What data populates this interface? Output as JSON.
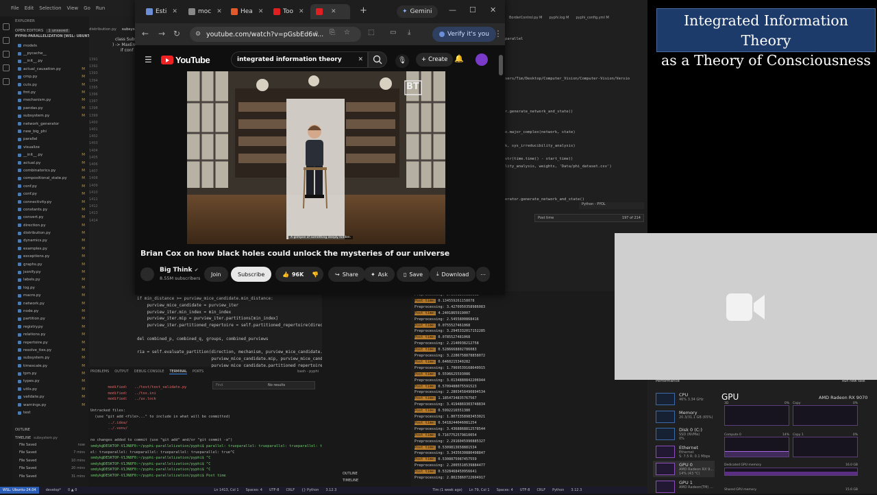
{
  "vscode": {
    "menu": [
      "File",
      "Edit",
      "Selection",
      "View",
      "Go",
      "Run"
    ],
    "explorer_title": "EXPLORER",
    "open_editors": "OPEN EDITORS",
    "open_editors_badge": "1 unsaved",
    "workspace": "PYPHI-PARALLELIZATION [WSL: UBUNTU-24.04]",
    "files": [
      {
        "name": "models",
        "status": ""
      },
      {
        "name": "__pycache__",
        "status": ""
      },
      {
        "name": "__init__.py",
        "status": ""
      },
      {
        "name": "actual_causation.py",
        "status": "M"
      },
      {
        "name": "cmp.py",
        "status": "M"
      },
      {
        "name": "cuts.py",
        "status": "M"
      },
      {
        "name": "fmt.py",
        "status": "M"
      },
      {
        "name": "mechanism.py",
        "status": "M"
      },
      {
        "name": "pandas.py",
        "status": "M"
      },
      {
        "name": "subsystem.py",
        "status": "M"
      },
      {
        "name": "network_generator",
        "status": ""
      },
      {
        "name": "new_big_phi",
        "status": ""
      },
      {
        "name": "parallel",
        "status": ""
      },
      {
        "name": "visualize",
        "status": ""
      },
      {
        "name": "__init__.py",
        "status": "M"
      },
      {
        "name": "actual.py",
        "status": "M"
      },
      {
        "name": "combinatorics.py",
        "status": "M"
      },
      {
        "name": "compositional_state.py",
        "status": "M"
      },
      {
        "name": "conf.py",
        "status": "M"
      },
      {
        "name": "conf.py",
        "status": "M"
      },
      {
        "name": "connectivity.py",
        "status": "M"
      },
      {
        "name": "constants.py",
        "status": "M"
      },
      {
        "name": "convert.py",
        "status": "M"
      },
      {
        "name": "direction.py",
        "status": "M"
      },
      {
        "name": "distribution.py",
        "status": "M"
      },
      {
        "name": "dynamics.py",
        "status": "M"
      },
      {
        "name": "examples.py",
        "status": "M"
      },
      {
        "name": "exceptions.py",
        "status": "M"
      },
      {
        "name": "graphs.py",
        "status": "M"
      },
      {
        "name": "jsonify.py",
        "status": "M"
      },
      {
        "name": "labels.py",
        "status": "M"
      },
      {
        "name": "log.py",
        "status": "M"
      },
      {
        "name": "macro.py",
        "status": "M"
      },
      {
        "name": "network.py",
        "status": "M"
      },
      {
        "name": "node.py",
        "status": "M"
      },
      {
        "name": "partition.py",
        "status": "M"
      },
      {
        "name": "registry.py",
        "status": "M"
      },
      {
        "name": "relations.py",
        "status": "M"
      },
      {
        "name": "repertoire.py",
        "status": "M"
      },
      {
        "name": "resolve_ties.py",
        "status": "M"
      },
      {
        "name": "subsystem.py",
        "status": "M"
      },
      {
        "name": "timescale.py",
        "status": "M"
      },
      {
        "name": "tpm.py",
        "status": "M"
      },
      {
        "name": "types.py",
        "status": "M"
      },
      {
        "name": "utils.py",
        "status": "M"
      },
      {
        "name": "validate.py",
        "status": "M"
      },
      {
        "name": "warnings.py",
        "status": "M"
      },
      {
        "name": "test",
        "status": ""
      }
    ],
    "outline": "OUTLINE",
    "timeline": "TIMELINE",
    "timeline_file": "subsystem.py",
    "timeline_items": [
      {
        "label": "File Saved",
        "time": "now"
      },
      {
        "label": "File Saved",
        "time": "7 mins"
      },
      {
        "label": "File Saved",
        "time": "10 mins"
      },
      {
        "label": "File Saved",
        "time": "20 mins"
      },
      {
        "label": "File Saved",
        "time": "31 mins"
      }
    ],
    "editor_tabs": [
      "distribution.py",
      "subsystem.py"
    ],
    "code_top": [
      "class Subsystem:",
      ") -> MaxEnt",
      "if conf"
    ],
    "code_bottom": [
      "if min_distance >= purview_mice_candidate.min_distance:",
      "    purview_mice_candidate = purview_iter",
      "    purview_iter.min_index = min_index",
      "    purview_iter.mip = purview_iter.partitions[min_index]",
      "    purview_iter.partitioned_repertoire = self.partitioned_repertoire(direction,",
      "",
      "del combined_p, combined_q, groups, combined_purviews",
      "",
      "ria = self.evaluate_partition(direction, mechanism, purview_mice_candidate.purview,",
      "                              purview_mice_candidate.mip, purview_mice_candidate.re",
      "                              purview_mice_candidate.partitioned_repertoire)"
    ],
    "line_numbers": [
      "1391",
      "1392",
      "1393",
      "1394",
      "1395",
      "1396",
      "1397",
      "1398",
      "1399",
      "1400",
      "1401",
      "1402",
      "1403",
      "1404",
      "1405",
      "1406",
      "1407",
      "1408",
      "1409",
      "1410",
      "1411",
      "1412",
      "1413",
      "1414"
    ],
    "panel_tabs": [
      "PROBLEMS",
      "OUTPUT",
      "DEBUG CONSOLE",
      "TERMINAL",
      "PORTS"
    ],
    "terminal_name": "bash - pyphi",
    "find_placeholder": "Find",
    "find_result": "No results",
    "terminal_lines": [
      {
        "text": "        modified:   ../test/test_validate.py",
        "cls": "red"
      },
      {
        "text": "        modified:   ../tox.ini",
        "cls": "red"
      },
      {
        "text": "        modified:   ../uv.lock",
        "cls": "red"
      },
      {
        "text": "",
        "cls": ""
      },
      {
        "text": "Untracked files:",
        "cls": ""
      },
      {
        "text": "  (use \"git add <file>...\" to include in what will be committed)",
        "cls": ""
      },
      {
        "text": "        ../.idea/",
        "cls": "red"
      },
      {
        "text": "        ../.venv/",
        "cls": "red"
      },
      {
        "text": "",
        "cls": ""
      },
      {
        "text": "no changes added to commit (use \"git add\" and/or \"git commit -a\")",
        "cls": ""
      },
      {
        "text": "smdyk@DESKTOP-V1JN8F0:~/pyphi-parallelization/pyphi$ parallel: trueparallel: trueparallel: trueparallel: trueparall",
        "cls": "grn"
      },
      {
        "text": "el: trueparallel: trueparallel: trueparallel: trueparallel: true^C",
        "cls": ""
      },
      {
        "text": "smdyk@DESKTOP-V1JN8F0:~/pyphi-parallelization/pyphi$ ^C",
        "cls": "grn"
      },
      {
        "text": "smdyk@DESKTOP-V1JN8F0:~/pyphi-parallelization/pyphi$ ^C",
        "cls": "grn"
      },
      {
        "text": "smdyk@DESKTOP-V1JN8F0:~/pyphi-parallelization/pyphi$ ^C",
        "cls": "grn"
      },
      {
        "text": "smdyk@DESKTOP-V1JN8F0:~/pyphi-parallelization/pyphi$ Post time",
        "cls": "grn"
      }
    ],
    "status_left": "WSL: Ubuntu-24.04",
    "status_branch": "develop*",
    "status_items": [
      "0 ▲ 0",
      "Ln 1413, Col 1",
      "Spaces: 4",
      "UTF-8",
      "CRLF",
      "{} Python",
      "3.12.3"
    ],
    "right_tabs": [
      "BorderControl.py M",
      "pyphi.log M",
      "pyphi_config.yml M"
    ],
    "right_code": [
      "parallel",
      "sers/Tim/Desktop/Computer_Vision/Computer-Vision/Versio",
      "r.generate_network_and_state()",
      "o.major_complex(network, state)",
      "k, sys_irreducibility_analysis)",
      "str(time.time() - start_time))",
      "lity_analysis, weights, 'Data/phi_dataset.csv')",
      "erator.generate_network_and_state()"
    ],
    "right_find": "Post time",
    "right_find_count": "197 of 214",
    "right_status": [
      "Tim (1 week ago)",
      "Ln 79, Col 1",
      "Spaces: 4",
      "UTF-8",
      "CRLF",
      "Python",
      "3.12.3"
    ],
    "output_lines": [
      {
        "label": "Preprocessing:",
        "value": "2.1551269385818"
      },
      {
        "label": "Post time:",
        "value": "0.134559261158078"
      },
      {
        "label": "Preprocessing:",
        "value": "3.4270950358986083"
      },
      {
        "label": "Post time:",
        "value": "4.2401865919007"
      },
      {
        "label": "Preprocessing:",
        "value": "2.5455800868416"
      },
      {
        "label": "Post time:",
        "value": "0.0755527461068"
      },
      {
        "label": "Preprocessing:",
        "value": "3.2945332017152285"
      },
      {
        "label": "Post time:",
        "value": "0.0785527481068"
      },
      {
        "label": "Preprocessing:",
        "value": "2.2140938212758"
      },
      {
        "label": "Post time:",
        "value": "0.5286668802786083"
      },
      {
        "label": "Preprocessing:",
        "value": "3.2286758878858072"
      },
      {
        "label": "Post time:",
        "value": "0.6460215340282"
      },
      {
        "label": "Preprocessing:",
        "value": "1.7969539168640915"
      },
      {
        "label": "Post time:",
        "value": "0.5596625593086"
      },
      {
        "label": "Preprocessing:",
        "value": "3.0134880842206944"
      },
      {
        "label": "Post time:",
        "value": "0.5709488075591523"
      },
      {
        "label": "Preprocessing:",
        "value": "2.2803458490894534"
      },
      {
        "label": "Post time:",
        "value": "1.1854734835767567"
      },
      {
        "label": "Preprocessing:",
        "value": "3.4194869303748834"
      },
      {
        "label": "Post time:",
        "value": "0.5992216551380"
      },
      {
        "label": "Preprocessing:",
        "value": "1.8073358983453021"
      },
      {
        "label": "Post time:",
        "value": "0.5418244046081254"
      },
      {
        "label": "Preprocessing:",
        "value": "3.4368868812578544"
      },
      {
        "label": "Post time:",
        "value": "0.7167752579810054"
      },
      {
        "label": "Preprocessing:",
        "value": "2.2916045990885327"
      },
      {
        "label": "Post time:",
        "value": "0.5309813658881534"
      },
      {
        "label": "Preprocessing:",
        "value": "3.3435630880498847"
      },
      {
        "label": "Post time:",
        "value": "0.5308875087457559"
      },
      {
        "label": "Preprocessing:",
        "value": "2.2005518539884477"
      },
      {
        "label": "Post time:",
        "value": "0.5328468450956641"
      },
      {
        "label": "Preprocessing:",
        "value": "2.8023860722604917"
      }
    ],
    "bottom_sections": [
      "OUTLINE",
      "TIMELINE"
    ]
  },
  "browser": {
    "tabs": [
      {
        "label": "Esti",
        "color": "#6b8fd6"
      },
      {
        "label": "moc",
        "color": "#888888"
      },
      {
        "label": "Hea",
        "color": "#e05a2a"
      },
      {
        "label": "Too",
        "color": "#e02020"
      },
      {
        "label": "",
        "color": "#e02020"
      }
    ],
    "gemini_label": "Gemini",
    "url": "youtube.com/watch?v=pGsbEd6w...",
    "verify_label": "Verify it's you"
  },
  "youtube": {
    "logo_text": "YouTube",
    "search_query": "integrated information theory",
    "create_label": "Create",
    "video_title": "Brian Cox on how black holes could unlock the mysteries of our universe",
    "caption": "A glimpse of something deeply hidden.",
    "watermark": "BT",
    "channel_name": "Big Think",
    "subscribers": "8.55M subscribers",
    "join_label": "Join",
    "subscribe_label": "Subscribe",
    "likes": "96K",
    "share_label": "Share",
    "ask_label": "Ask",
    "save_label": "Save",
    "download_label": "Download"
  },
  "slide": {
    "line1": "Integrated Information Theory",
    "line2": "as a Theory of Consciousness"
  },
  "taskmgr": {
    "title": "Performance",
    "run_task": "Run new task",
    "items": [
      {
        "label": "CPU",
        "sub": "46% 3.34 GHz"
      },
      {
        "label": "Memory",
        "sub": "20.3/31.1 GB (65%)"
      },
      {
        "label": "Disk 0 (C:)",
        "sub": "SSD (NVMe)\n0%"
      },
      {
        "label": "Ethernet",
        "sub": "Ethernet\nS: 7.5 R: 0.1 Mbps"
      },
      {
        "label": "GPU 0",
        "sub": "AMD Radeon RX 9...\n14% (43 °C)"
      },
      {
        "label": "GPU 1",
        "sub": "AMD Radeon(TM) ..."
      }
    ],
    "gpu_title": "GPU",
    "gpu_model": "AMD Radeon RX 9070",
    "graphs": [
      {
        "label": "3D",
        "value": "0%"
      },
      {
        "label": "Copy",
        "value": "0%"
      },
      {
        "label": "Compute 0",
        "value": "14%"
      },
      {
        "label": "Copy 1",
        "value": "0%"
      }
    ],
    "dedicated_label": "Dedicated GPU memory",
    "dedicated_value": "16.0 GB",
    "shared_label": "Shared GPU memory",
    "shared_value": "15.6 GB"
  }
}
